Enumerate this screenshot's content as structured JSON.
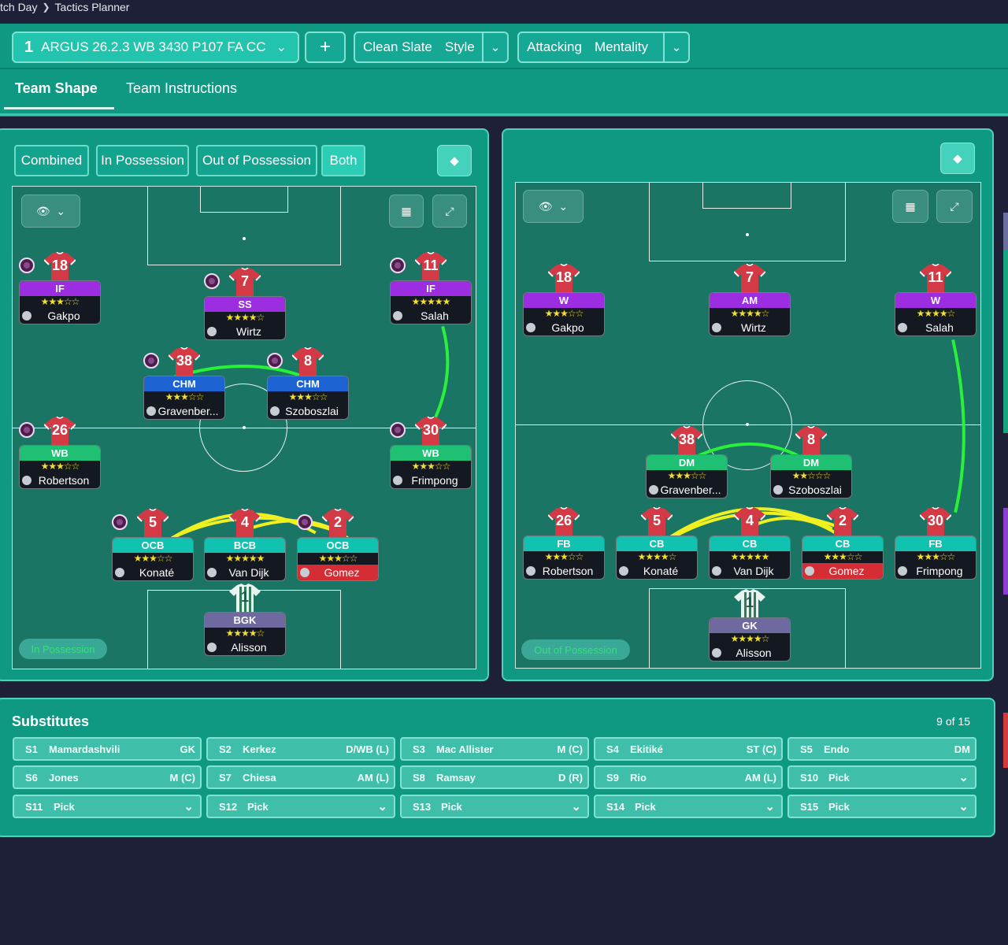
{
  "breadcrumb": {
    "parent": "tch Day",
    "current": "Tactics Planner"
  },
  "tactic": {
    "number": "1",
    "name": "ARGUS 26.2.3 WB 3430 P107 FA CC",
    "add_label": "+"
  },
  "style": {
    "value": "Clean Slate",
    "label": "Style"
  },
  "mentality": {
    "value": "Attacking",
    "label": "Mentality"
  },
  "tabs": [
    "Team Shape",
    "Team Instructions"
  ],
  "phase_tabs": [
    "Combined",
    "In Possession",
    "Out of Possession",
    "Both"
  ],
  "pitch_left_label": "In Possession",
  "pitch_right_label": "Out of Possession",
  "colors": {
    "attack": "#9c2de0",
    "midfield_blue": "#1e63d4",
    "green": "#1fbf74",
    "teal": "#12c2b0",
    "gk": "#6e6aa0",
    "star": "#f2de2f",
    "link_yellow": "#f0f020",
    "link_green": "#2bf03a"
  },
  "left_players": [
    {
      "num": "18",
      "role": "IF",
      "name": "Gakpo",
      "stars": "★★★☆☆",
      "role_color": "#9c2de0",
      "badge": true,
      "warn": false
    },
    {
      "num": "7",
      "role": "SS",
      "name": "Wirtz",
      "stars": "★★★★☆",
      "role_color": "#9c2de0",
      "badge": true,
      "warn": false
    },
    {
      "num": "11",
      "role": "IF",
      "name": "Salah",
      "stars": "★★★★★",
      "role_color": "#9c2de0",
      "badge": true,
      "warn": false
    },
    {
      "num": "38",
      "role": "CHM",
      "name": "Gravenber...",
      "stars": "★★★☆☆",
      "role_color": "#1e63d4",
      "badge": true,
      "warn": false
    },
    {
      "num": "8",
      "role": "CHM",
      "name": "Szoboszlai",
      "stars": "★★★☆☆",
      "role_color": "#1e63d4",
      "badge": true,
      "warn": false
    },
    {
      "num": "26",
      "role": "WB",
      "name": "Robertson",
      "stars": "★★★☆☆",
      "role_color": "#1fbf74",
      "badge": true,
      "warn": false
    },
    {
      "num": "30",
      "role": "WB",
      "name": "Frimpong",
      "stars": "★★★☆☆",
      "role_color": "#1fbf74",
      "badge": true,
      "warn": false
    },
    {
      "num": "5",
      "role": "OCB",
      "name": "Konaté",
      "stars": "★★★☆☆",
      "role_color": "#12c2b0",
      "badge": true,
      "warn": false
    },
    {
      "num": "4",
      "role": "BCB",
      "name": "Van Dijk",
      "stars": "★★★★★",
      "role_color": "#12c2b0",
      "badge": false,
      "warn": false
    },
    {
      "num": "2",
      "role": "OCB",
      "name": "Gomez",
      "stars": "★★★☆☆",
      "role_color": "#12c2b0",
      "badge": true,
      "warn": true
    },
    {
      "num": "1",
      "role": "BGK",
      "name": "Alisson",
      "stars": "★★★★☆",
      "role_color": "#6e6aa0",
      "badge": false,
      "warn": false,
      "gk": true
    }
  ],
  "right_players": [
    {
      "num": "18",
      "role": "W",
      "name": "Gakpo",
      "stars": "★★★☆☆",
      "role_color": "#9c2de0",
      "warn": false
    },
    {
      "num": "7",
      "role": "AM",
      "name": "Wirtz",
      "stars": "★★★★☆",
      "role_color": "#9c2de0",
      "warn": false
    },
    {
      "num": "11",
      "role": "W",
      "name": "Salah",
      "stars": "★★★★☆",
      "role_color": "#9c2de0",
      "warn": false
    },
    {
      "num": "38",
      "role": "DM",
      "name": "Gravenber...",
      "stars": "★★★☆☆",
      "role_color": "#1fbf74",
      "warn": false
    },
    {
      "num": "8",
      "role": "DM",
      "name": "Szoboszlai",
      "stars": "★★☆☆☆",
      "role_color": "#1fbf74",
      "warn": false
    },
    {
      "num": "26",
      "role": "FB",
      "name": "Robertson",
      "stars": "★★★☆☆",
      "role_color": "#12c2b0",
      "warn": false
    },
    {
      "num": "5",
      "role": "CB",
      "name": "Konaté",
      "stars": "★★★★☆",
      "role_color": "#12c2b0",
      "warn": false
    },
    {
      "num": "4",
      "role": "CB",
      "name": "Van Dijk",
      "stars": "★★★★★",
      "role_color": "#12c2b0",
      "warn": false
    },
    {
      "num": "2",
      "role": "CB",
      "name": "Gomez",
      "stars": "★★★☆☆",
      "role_color": "#12c2b0",
      "warn": true
    },
    {
      "num": "30",
      "role": "FB",
      "name": "Frimpong",
      "stars": "★★★☆☆",
      "role_color": "#12c2b0",
      "warn": false
    },
    {
      "num": "1",
      "role": "GK",
      "name": "Alisson",
      "stars": "★★★★☆",
      "role_color": "#6e6aa0",
      "warn": false,
      "gk": true
    }
  ],
  "substitutes": {
    "title": "Substitutes",
    "count": "9 of 15",
    "slots": [
      {
        "id": "S1",
        "name": "Mamardashvili",
        "pos": "GK"
      },
      {
        "id": "S2",
        "name": "Kerkez",
        "pos": "D/WB (L)"
      },
      {
        "id": "S3",
        "name": "Mac Allister",
        "pos": "M (C)"
      },
      {
        "id": "S4",
        "name": "Ekitiké",
        "pos": "ST (C)"
      },
      {
        "id": "S5",
        "name": "Endo",
        "pos": "DM"
      },
      {
        "id": "S6",
        "name": "Jones",
        "pos": "M (C)"
      },
      {
        "id": "S7",
        "name": "Chiesa",
        "pos": "AM (L)"
      },
      {
        "id": "S8",
        "name": "Ramsay",
        "pos": "D (R)"
      },
      {
        "id": "S9",
        "name": "Rio",
        "pos": "AM (L)"
      },
      {
        "id": "S10",
        "name": "Pick",
        "pos": ""
      },
      {
        "id": "S11",
        "name": "Pick",
        "pos": ""
      },
      {
        "id": "S12",
        "name": "Pick",
        "pos": ""
      },
      {
        "id": "S13",
        "name": "Pick",
        "pos": ""
      },
      {
        "id": "S14",
        "name": "Pick",
        "pos": ""
      },
      {
        "id": "S15",
        "name": "Pick",
        "pos": ""
      }
    ]
  }
}
